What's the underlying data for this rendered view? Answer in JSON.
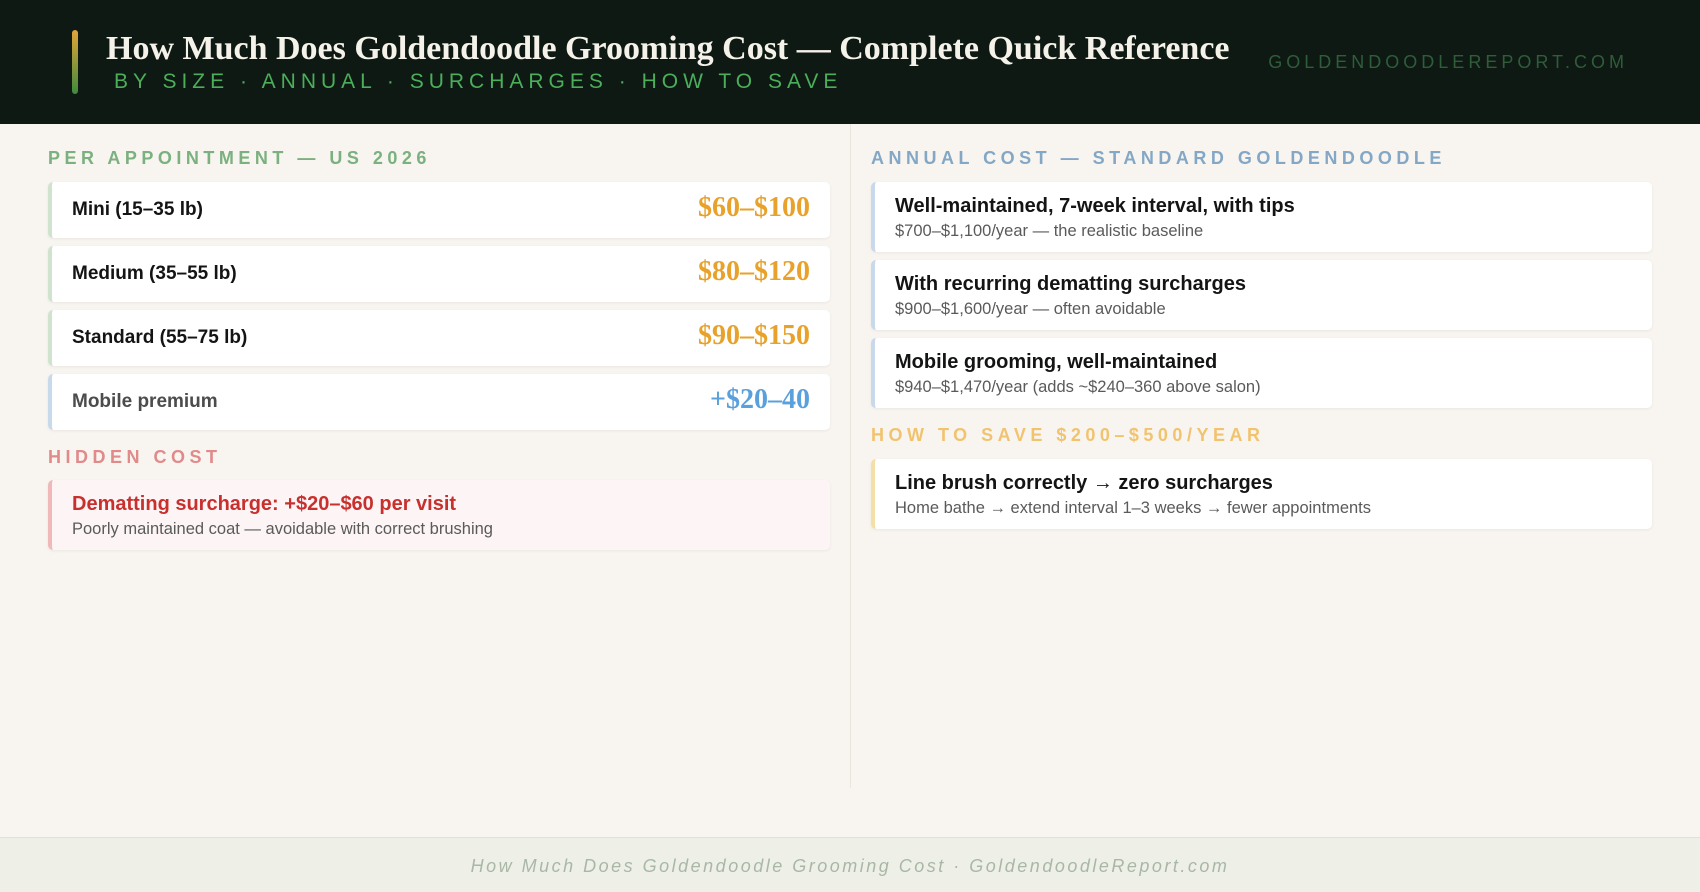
{
  "header": {
    "title": "How Much Does Goldendoodle Grooming Cost — Complete Quick Reference",
    "subtitle": "BY SIZE · ANNUAL · SURCHARGES · HOW TO SAVE",
    "brand": "GOLDENDOODLEREPORT.COM"
  },
  "per_appointment": {
    "label": "PER APPOINTMENT — US 2026",
    "rows": [
      {
        "label": "Mini (15–35 lb)",
        "price": "$60–$100"
      },
      {
        "label": "Medium (35–55 lb)",
        "price": "$80–$120"
      },
      {
        "label": "Standard (55–75 lb)",
        "price": "$90–$150"
      },
      {
        "label": "Mobile premium",
        "price": "+$20–40"
      }
    ]
  },
  "hidden_cost": {
    "label": "HIDDEN COST",
    "title": "Dematting surcharge: +$20–$60 per visit",
    "desc": "Poorly maintained coat — avoidable with correct brushing"
  },
  "annual_cost": {
    "label": "ANNUAL COST — STANDARD GOLDENDOODLE",
    "items": [
      {
        "title": "Well-maintained, 7-week interval, with tips",
        "desc": "$700–$1,100/year — the realistic baseline"
      },
      {
        "title": "With recurring dematting surcharges",
        "desc": "$900–$1,600/year — often avoidable"
      },
      {
        "title": "Mobile grooming, well-maintained",
        "desc": "$940–$1,470/year (adds ~$240–360 above salon)"
      }
    ]
  },
  "how_to_save": {
    "label": "HOW TO SAVE $200–$500/YEAR",
    "title": "Line brush correctly → zero surcharges",
    "desc": "Home bathe → extend interval 1–3 weeks → fewer appointments"
  },
  "footer": {
    "text": "How Much Does Goldendoodle Grooming Cost · GoldendoodleReport.com"
  },
  "colors": {
    "header_bg": "#0d1912",
    "price_gold": "#e8a22b",
    "price_blue": "#5aa0dc",
    "alert_red": "#c8302e",
    "subtitle_green": "#4cae5b"
  }
}
